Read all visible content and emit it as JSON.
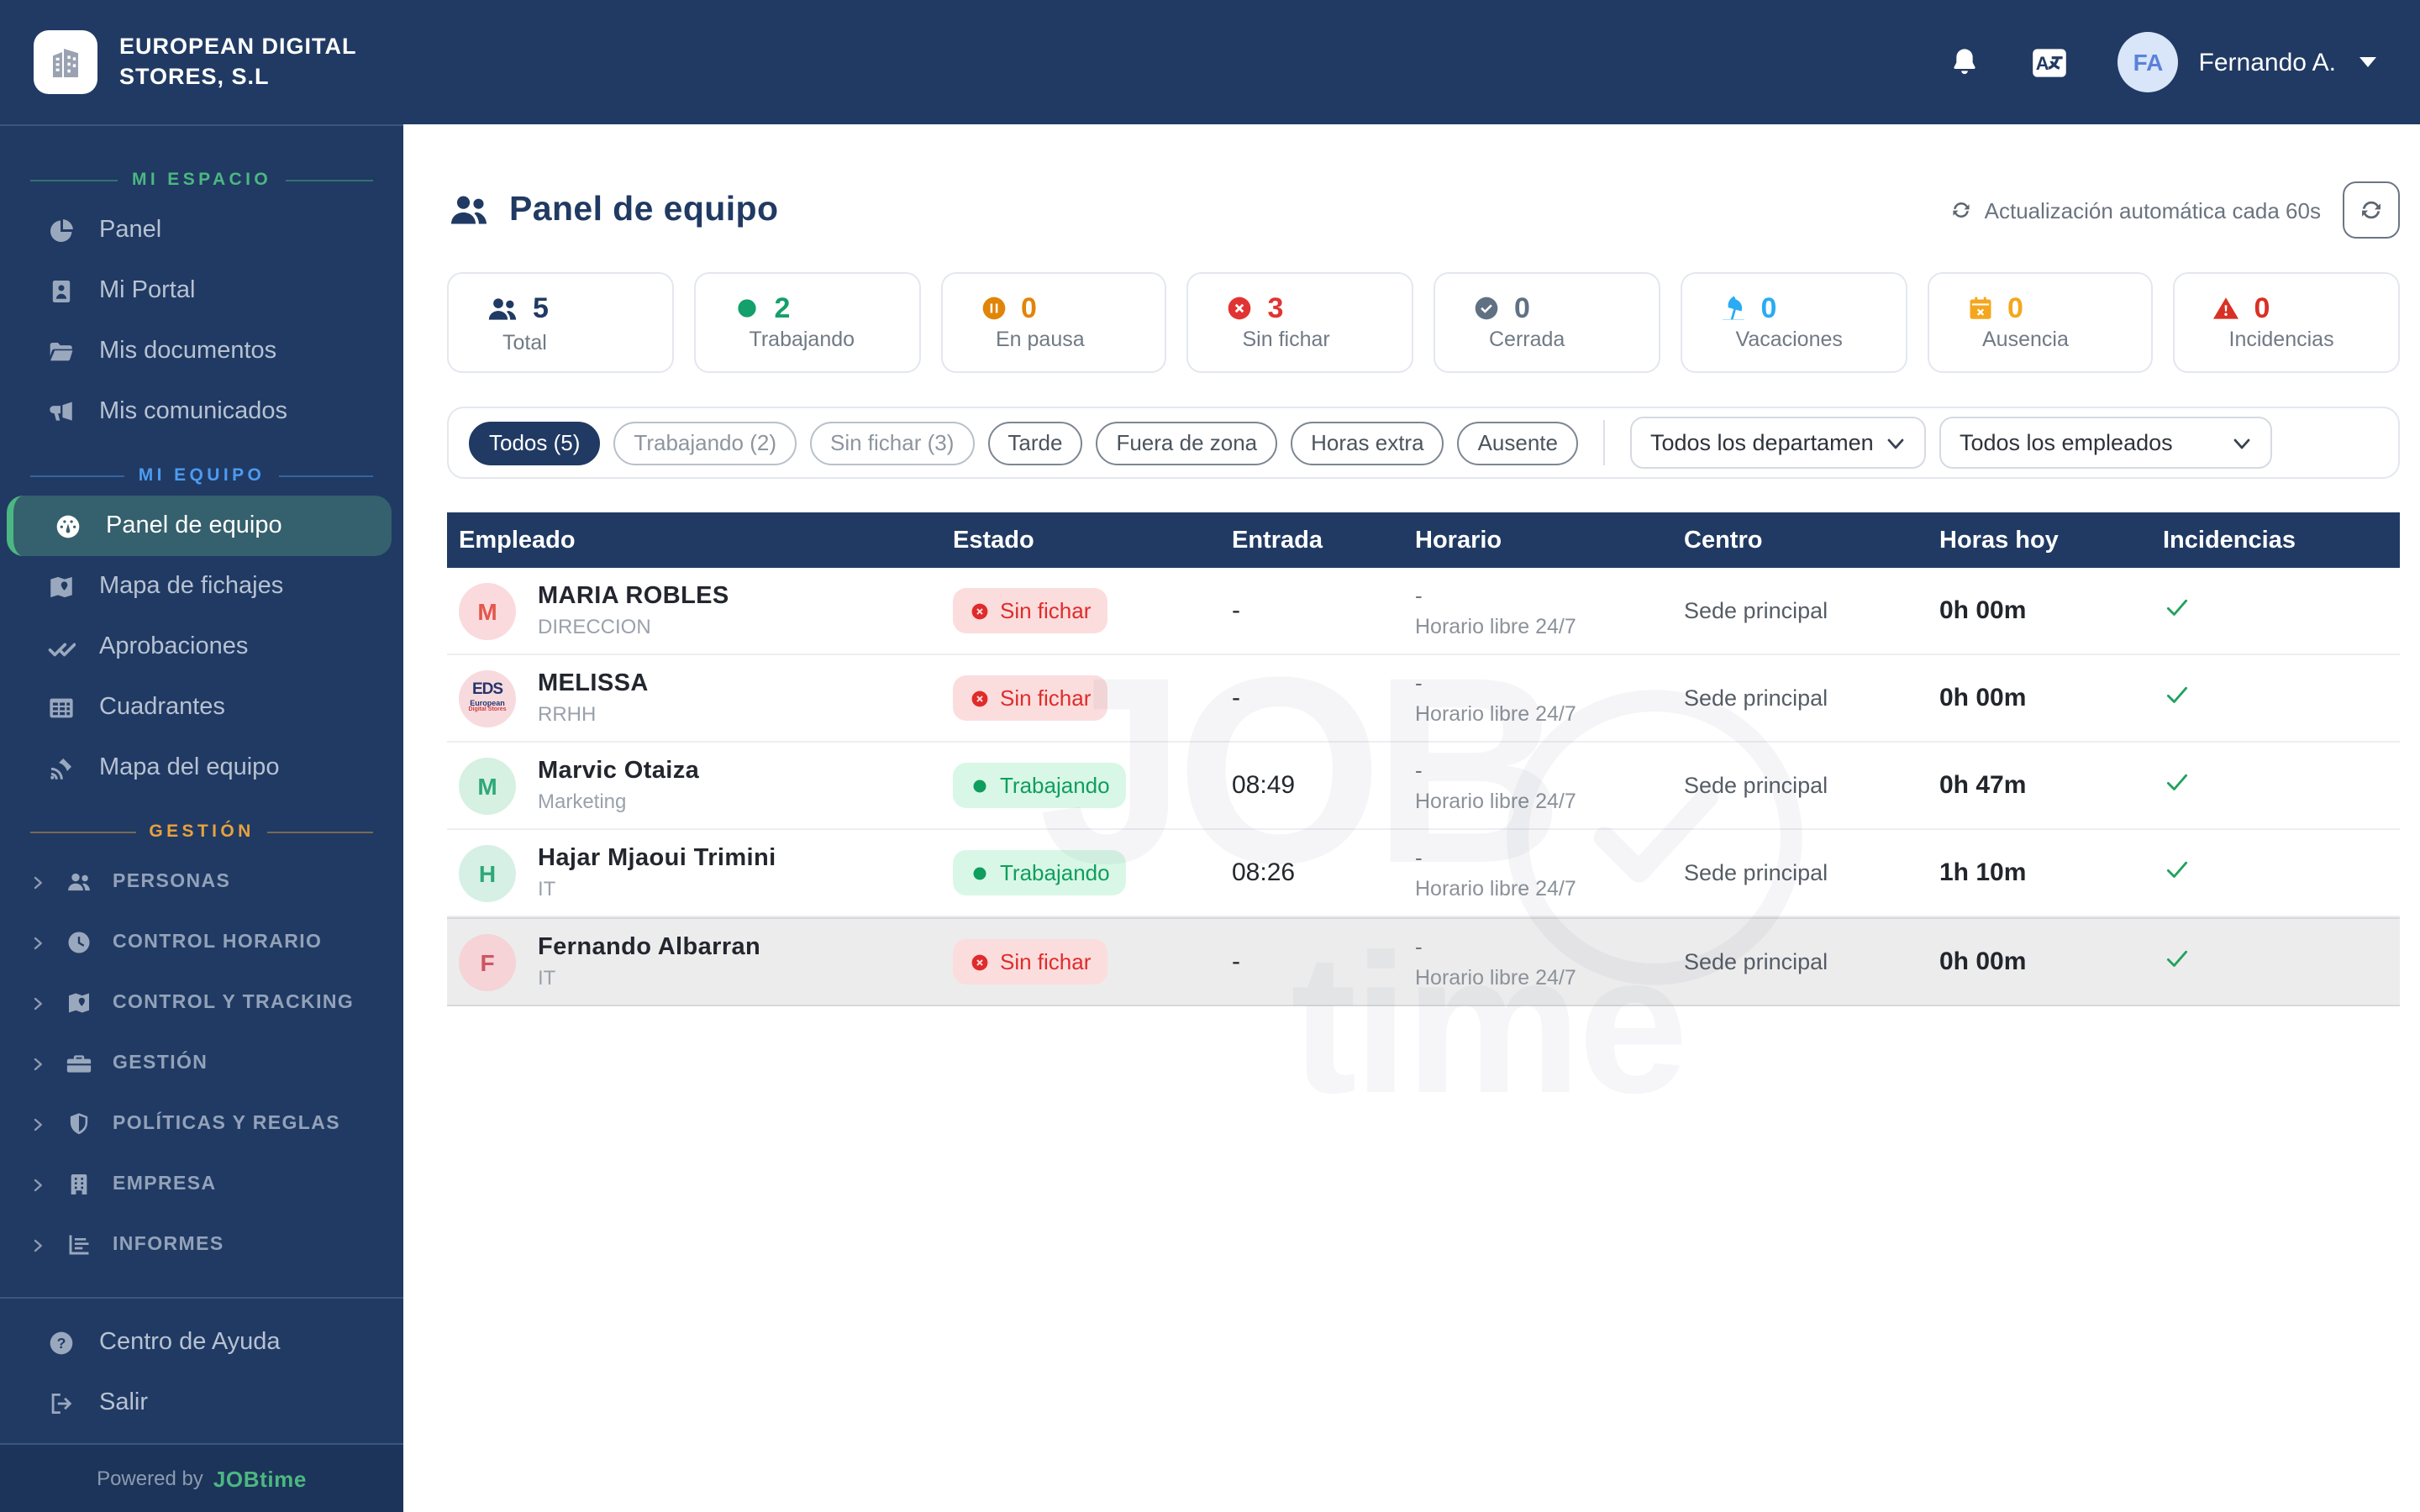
{
  "colors": {
    "navy": "#203a63",
    "brand_green": "#4cb782",
    "section_blue": "#4d9bf1",
    "section_orange": "#e8a23d",
    "active_item_bg": "#35606d",
    "red": "#e02b2b",
    "green": "#0f9e5e",
    "sky": "#2aabf3",
    "amber": "#f4a71d",
    "orange": "#e08507",
    "gray": "#5f7183",
    "danger": "#d93025"
  },
  "navbar": {
    "company_name": "EUROPEAN DIGITAL\nSTORES, S.L",
    "logo_icon": "building-logo",
    "bell_icon": "bell",
    "translate_icon": "translate",
    "user": {
      "initials": "FA",
      "name": "Fernando A."
    }
  },
  "sidebar": {
    "sections": [
      {
        "label": "MI ESPACIO",
        "color": "#4cb782",
        "group": false,
        "items": [
          {
            "label": "Panel",
            "icon": "pie-chart"
          },
          {
            "label": "Mi Portal",
            "icon": "id-card"
          },
          {
            "label": "Mis documentos",
            "icon": "folder"
          },
          {
            "label": "Mis comunicados",
            "icon": "megaphone"
          }
        ]
      },
      {
        "label": "MI EQUIPO",
        "color": "#4d9bf1",
        "group": false,
        "items": [
          {
            "label": "Panel de equipo",
            "icon": "gauge",
            "active": true
          },
          {
            "label": "Mapa de fichajes",
            "icon": "map"
          },
          {
            "label": "Aprobaciones",
            "icon": "double-check"
          },
          {
            "label": "Cuadrantes",
            "icon": "grid"
          },
          {
            "label": "Mapa del equipo",
            "icon": "satellite"
          }
        ]
      },
      {
        "label": "GESTIÓN",
        "color": "#e8a23d",
        "group": true,
        "items": [
          {
            "label": "PERSONAS",
            "icon": "users"
          },
          {
            "label": "CONTROL HORARIO",
            "icon": "clock"
          },
          {
            "label": "CONTROL Y TRACKING",
            "icon": "map"
          },
          {
            "label": "GESTIÓN",
            "icon": "briefcase"
          },
          {
            "label": "POLÍTICAS Y REGLAS",
            "icon": "shield"
          },
          {
            "label": "EMPRESA",
            "icon": "building"
          },
          {
            "label": "INFORMES",
            "icon": "chart"
          }
        ]
      }
    ],
    "footer_items": [
      {
        "label": "Centro de Ayuda",
        "icon": "help-circle"
      },
      {
        "label": "Salir",
        "icon": "sign-out"
      }
    ],
    "powered_prefix": "Powered by",
    "powered_brand": "JOBtime"
  },
  "header": {
    "title": "Panel de equipo",
    "title_icon": "users",
    "auto_refresh_label": "Actualización automática cada 60s",
    "refresh_icon": "refresh"
  },
  "stats": [
    {
      "value": "5",
      "label": "Total",
      "icon": "users",
      "color": "#203a63"
    },
    {
      "value": "2",
      "label": "Trabajando",
      "icon": "dot",
      "color": "#13a06a"
    },
    {
      "value": "0",
      "label": "En pausa",
      "icon": "pause-circle",
      "color": "#e08507"
    },
    {
      "value": "3",
      "label": "Sin fichar",
      "icon": "x-circle",
      "color": "#e23333"
    },
    {
      "value": "0",
      "label": "Cerrada",
      "icon": "check-circle",
      "color": "#5f7183"
    },
    {
      "value": "0",
      "label": "Vacaciones",
      "icon": "beach-umbrella",
      "color": "#2aabf3"
    },
    {
      "value": "0",
      "label": "Ausencia",
      "icon": "calendar-x",
      "color": "#f4a71d"
    },
    {
      "value": "0",
      "label": "Incidencias",
      "icon": "warning-triangle",
      "color": "#d93025"
    }
  ],
  "filters": {
    "pills": [
      {
        "label": "Todos (5)",
        "style": "active"
      },
      {
        "label": "Trabajando (2)",
        "style": "muted"
      },
      {
        "label": "Sin fichar (3)",
        "style": "muted"
      },
      {
        "label": "Tarde",
        "style": "normal"
      },
      {
        "label": "Fuera de zona",
        "style": "normal"
      },
      {
        "label": "Horas extra",
        "style": "normal"
      },
      {
        "label": "Ausente",
        "style": "normal"
      }
    ],
    "selects": [
      {
        "value": "Todos los departamen",
        "width": 176
      },
      {
        "value": "Todos los empleados",
        "width": 198
      }
    ]
  },
  "table": {
    "columns": [
      "Empleado",
      "Estado",
      "Entrada",
      "Horario",
      "Centro",
      "Horas hoy",
      "Incidencias"
    ],
    "rows": [
      {
        "name": "MARIA ROBLES",
        "dept": "DIRECCION",
        "avatar": {
          "type": "initial",
          "text": "M",
          "bg": "#fadadd",
          "fg": "#e2574c"
        },
        "status": {
          "label": "Sin fichar",
          "type": "red",
          "icon": "x-circle"
        },
        "entrada": "-",
        "horario_line1": "-",
        "horario_line2": "Horario libre 24/7",
        "centro": "Sede principal",
        "horas": "0h 00m",
        "incidencias_ok": true,
        "highlighted": false
      },
      {
        "name": "MELISSA",
        "dept": "RRHH",
        "avatar": {
          "type": "logo",
          "line1": "EDS",
          "line2": "European",
          "line3": "Digital Stores"
        },
        "status": {
          "label": "Sin fichar",
          "type": "red",
          "icon": "x-circle"
        },
        "entrada": "-",
        "horario_line1": "-",
        "horario_line2": "Horario libre 24/7",
        "centro": "Sede principal",
        "horas": "0h 00m",
        "incidencias_ok": true,
        "highlighted": false
      },
      {
        "name": "Marvic Otaiza",
        "dept": "Marketing",
        "avatar": {
          "type": "initial",
          "text": "M",
          "bg": "#d6f0e2",
          "fg": "#2ea878"
        },
        "status": {
          "label": "Trabajando",
          "type": "green",
          "icon": "dot"
        },
        "entrada": "08:49",
        "horario_line1": "-",
        "horario_line2": "Horario libre 24/7",
        "centro": "Sede principal",
        "horas": "0h 47m",
        "incidencias_ok": true,
        "highlighted": false
      },
      {
        "name": "Hajar Mjaoui Trimini",
        "dept": "IT",
        "avatar": {
          "type": "initial",
          "text": "H",
          "bg": "#d6f0e6",
          "fg": "#2ea878"
        },
        "status": {
          "label": "Trabajando",
          "type": "green",
          "icon": "dot"
        },
        "entrada": "08:26",
        "horario_line1": "-",
        "horario_line2": "Horario libre 24/7",
        "centro": "Sede principal",
        "horas": "1h 10m",
        "incidencias_ok": true,
        "highlighted": false
      },
      {
        "name": "Fernando Albarran",
        "dept": "IT",
        "avatar": {
          "type": "initial",
          "text": "F",
          "bg": "#f5d3d7",
          "fg": "#cf5560"
        },
        "status": {
          "label": "Sin fichar",
          "type": "red",
          "icon": "x-circle"
        },
        "entrada": "-",
        "horario_line1": "-",
        "horario_line2": "Horario libre 24/7",
        "centro": "Sede principal",
        "horas": "0h 00m",
        "incidencias_ok": true,
        "highlighted": true
      }
    ]
  },
  "watermark": {
    "word1": "JOB",
    "word2": "time",
    "clock_icon": "wm-clock"
  }
}
